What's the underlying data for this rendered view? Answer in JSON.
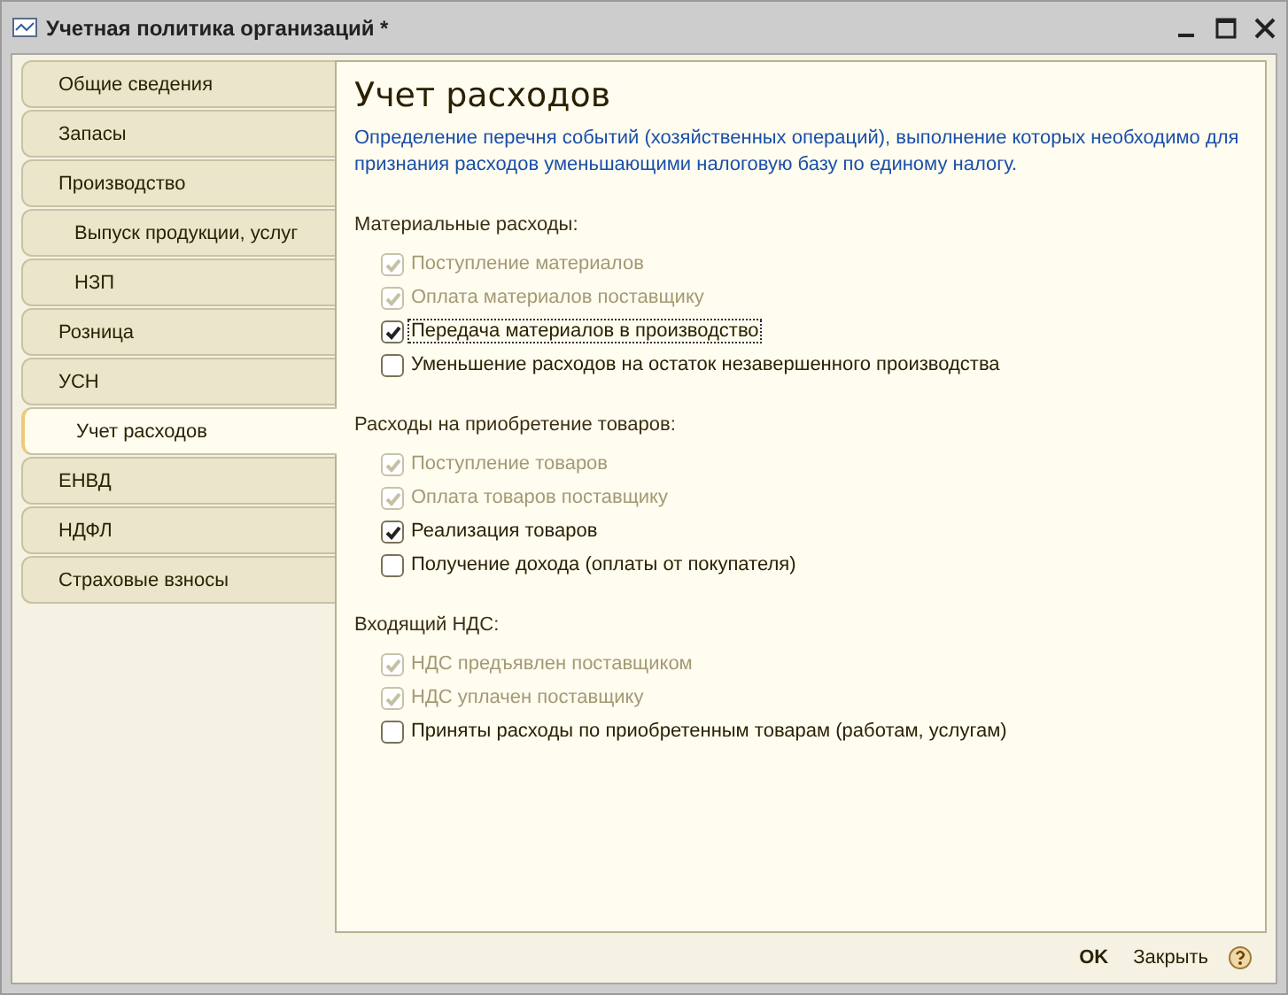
{
  "window": {
    "title": "Учетная политика организаций *"
  },
  "sidebar": {
    "items": [
      {
        "label": "Общие сведения",
        "selected": false,
        "nested": false
      },
      {
        "label": "Запасы",
        "selected": false,
        "nested": false
      },
      {
        "label": "Производство",
        "selected": false,
        "nested": false
      },
      {
        "label": "Выпуск продукции, услуг",
        "selected": false,
        "nested": true
      },
      {
        "label": "НЗП",
        "selected": false,
        "nested": true
      },
      {
        "label": "Розница",
        "selected": false,
        "nested": false
      },
      {
        "label": "УСН",
        "selected": false,
        "nested": false
      },
      {
        "label": "Учет расходов",
        "selected": true,
        "nested": true
      },
      {
        "label": "ЕНВД",
        "selected": false,
        "nested": false
      },
      {
        "label": "НДФЛ",
        "selected": false,
        "nested": false
      },
      {
        "label": "Страховые взносы",
        "selected": false,
        "nested": false
      }
    ]
  },
  "content": {
    "heading": "Учет расходов",
    "description": "Определение перечня событий (хозяйственных операций), выполнение которых необходимо для признания расходов уменьшающими налоговую базу по единому налогу.",
    "groups": [
      {
        "title": "Материальные расходы:",
        "options": [
          {
            "label": "Поступление материалов",
            "checked": true,
            "disabled": true,
            "focused": false
          },
          {
            "label": "Оплата материалов поставщику",
            "checked": true,
            "disabled": true,
            "focused": false
          },
          {
            "label": "Передача материалов в производство",
            "checked": true,
            "disabled": false,
            "focused": true
          },
          {
            "label": "Уменьшение расходов на остаток незавершенного производства",
            "checked": false,
            "disabled": false,
            "focused": false
          }
        ]
      },
      {
        "title": "Расходы на приобретение товаров:",
        "options": [
          {
            "label": "Поступление товаров",
            "checked": true,
            "disabled": true,
            "focused": false
          },
          {
            "label": "Оплата товаров поставщику",
            "checked": true,
            "disabled": true,
            "focused": false
          },
          {
            "label": "Реализация товаров",
            "checked": true,
            "disabled": false,
            "focused": false
          },
          {
            "label": "Получение дохода (оплаты от покупателя)",
            "checked": false,
            "disabled": false,
            "focused": false
          }
        ]
      },
      {
        "title": "Входящий НДС:",
        "options": [
          {
            "label": "НДС предъявлен поставщиком",
            "checked": true,
            "disabled": true,
            "focused": false
          },
          {
            "label": "НДС уплачен поставщику",
            "checked": true,
            "disabled": true,
            "focused": false
          },
          {
            "label": "Приняты расходы по приобретенным товарам (работам, услугам)",
            "checked": false,
            "disabled": false,
            "focused": false
          }
        ]
      }
    ]
  },
  "buttons": [
    {
      "label": "OK",
      "kind": "default"
    },
    {
      "label": "Закрыть",
      "kind": "normal"
    }
  ]
}
